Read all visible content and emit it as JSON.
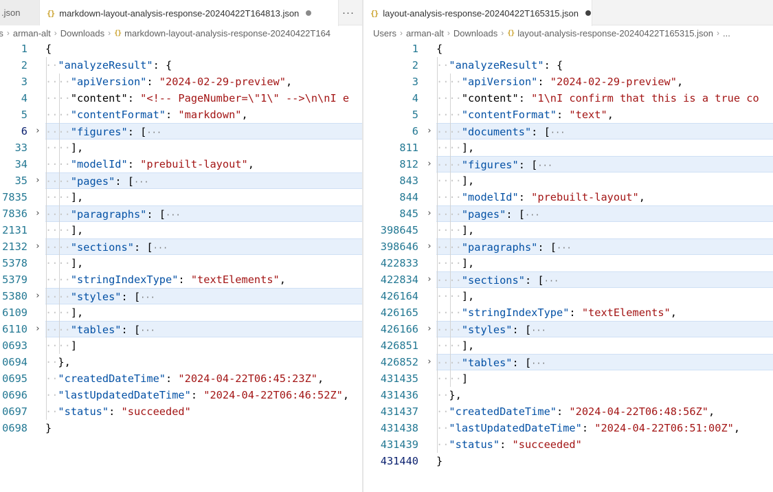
{
  "left": {
    "tabs": [
      {
        "label": ".json",
        "active": false,
        "dirty": false
      },
      {
        "label": "markdown-layout-analysis-response-20240422T164813.json",
        "active": true,
        "dirty": true
      }
    ],
    "more_actions": "···",
    "breadcrumb": [
      "rs",
      "arman-alt",
      "Downloads",
      "markdown-layout-analysis-response-20240422T164"
    ],
    "lines": [
      {
        "n": "1",
        "ind": 0,
        "t": [
          [
            "punc",
            "{"
          ]
        ]
      },
      {
        "n": "2",
        "ind": 1,
        "t": [
          [
            "key",
            "\"analyzeResult\""
          ],
          [
            "punc",
            ": {"
          ]
        ]
      },
      {
        "n": "3",
        "ind": 2,
        "t": [
          [
            "key",
            "\"apiVersion\""
          ],
          [
            "punc",
            ": "
          ],
          [
            "str",
            "\"2024-02-29-preview\""
          ],
          [
            "punc",
            ","
          ]
        ]
      },
      {
        "n": "4",
        "ind": 2,
        "t": [
          [
            "punc",
            "\"content\": "
          ],
          [
            "str",
            "\"<!-- PageNumber=\\\"1\\\" -->\\n\\nI e"
          ]
        ]
      },
      {
        "n": "5",
        "ind": 2,
        "t": [
          [
            "key",
            "\"contentFormat\""
          ],
          [
            "punc",
            ": "
          ],
          [
            "str",
            "\"markdown\""
          ],
          [
            "punc",
            ","
          ]
        ]
      },
      {
        "n": "6",
        "ind": 2,
        "fold": true,
        "current": true,
        "t": [
          [
            "key",
            "\"figures\""
          ],
          [
            "punc",
            ": ["
          ],
          [
            "ellipsis",
            "···"
          ]
        ]
      },
      {
        "n": "33",
        "ind": 2,
        "t": [
          [
            "punc",
            "],"
          ]
        ]
      },
      {
        "n": "34",
        "ind": 2,
        "t": [
          [
            "key",
            "\"modelId\""
          ],
          [
            "punc",
            ": "
          ],
          [
            "str",
            "\"prebuilt-layout\""
          ],
          [
            "punc",
            ","
          ]
        ]
      },
      {
        "n": "35",
        "ind": 2,
        "fold": true,
        "t": [
          [
            "key",
            "\"pages\""
          ],
          [
            "punc",
            ": ["
          ],
          [
            "ellipsis",
            "···"
          ]
        ]
      },
      {
        "n": "7835",
        "ind": 2,
        "t": [
          [
            "punc",
            "],"
          ]
        ]
      },
      {
        "n": "7836",
        "ind": 2,
        "fold": true,
        "t": [
          [
            "key",
            "\"paragraphs\""
          ],
          [
            "punc",
            ": ["
          ],
          [
            "ellipsis",
            "···"
          ]
        ]
      },
      {
        "n": "2131",
        "ind": 2,
        "t": [
          [
            "punc",
            "],"
          ]
        ]
      },
      {
        "n": "2132",
        "ind": 2,
        "fold": true,
        "t": [
          [
            "key",
            "\"sections\""
          ],
          [
            "punc",
            ": ["
          ],
          [
            "ellipsis",
            "···"
          ]
        ]
      },
      {
        "n": "5378",
        "ind": 2,
        "t": [
          [
            "punc",
            "],"
          ]
        ]
      },
      {
        "n": "5379",
        "ind": 2,
        "t": [
          [
            "key",
            "\"stringIndexType\""
          ],
          [
            "punc",
            ": "
          ],
          [
            "str",
            "\"textElements\""
          ],
          [
            "punc",
            ","
          ]
        ]
      },
      {
        "n": "5380",
        "ind": 2,
        "fold": true,
        "t": [
          [
            "key",
            "\"styles\""
          ],
          [
            "punc",
            ": ["
          ],
          [
            "ellipsis",
            "···"
          ]
        ]
      },
      {
        "n": "6109",
        "ind": 2,
        "t": [
          [
            "punc",
            "],"
          ]
        ]
      },
      {
        "n": "6110",
        "ind": 2,
        "fold": true,
        "t": [
          [
            "key",
            "\"tables\""
          ],
          [
            "punc",
            ": ["
          ],
          [
            "ellipsis",
            "···"
          ]
        ]
      },
      {
        "n": "0693",
        "ind": 2,
        "t": [
          [
            "punc",
            "]"
          ]
        ]
      },
      {
        "n": "0694",
        "ind": 1,
        "t": [
          [
            "punc",
            "},"
          ]
        ]
      },
      {
        "n": "0695",
        "ind": 1,
        "t": [
          [
            "key",
            "\"createdDateTime\""
          ],
          [
            "punc",
            ": "
          ],
          [
            "str",
            "\"2024-04-22T06:45:23Z\""
          ],
          [
            "punc",
            ","
          ]
        ]
      },
      {
        "n": "0696",
        "ind": 1,
        "t": [
          [
            "key",
            "\"lastUpdatedDateTime\""
          ],
          [
            "punc",
            ": "
          ],
          [
            "str",
            "\"2024-04-22T06:46:52Z\""
          ],
          [
            "punc",
            ","
          ]
        ]
      },
      {
        "n": "0697",
        "ind": 1,
        "t": [
          [
            "key",
            "\"status\""
          ],
          [
            "punc",
            ": "
          ],
          [
            "str",
            "\"succeeded\""
          ]
        ]
      },
      {
        "n": "0698",
        "ind": 0,
        "t": [
          [
            "punc",
            "}"
          ]
        ]
      }
    ]
  },
  "right": {
    "tabs": [
      {
        "label": "layout-analysis-response-20240422T165315.json",
        "active": true,
        "dirty": true
      }
    ],
    "breadcrumb": [
      "Users",
      "arman-alt",
      "Downloads",
      "layout-analysis-response-20240422T165315.json",
      "..."
    ],
    "lines": [
      {
        "n": "1",
        "ind": 0,
        "t": [
          [
            "punc",
            "{"
          ]
        ]
      },
      {
        "n": "2",
        "ind": 1,
        "t": [
          [
            "key",
            "\"analyzeResult\""
          ],
          [
            "punc",
            ": {"
          ]
        ]
      },
      {
        "n": "3",
        "ind": 2,
        "t": [
          [
            "key",
            "\"apiVersion\""
          ],
          [
            "punc",
            ": "
          ],
          [
            "str",
            "\"2024-02-29-preview\""
          ],
          [
            "punc",
            ","
          ]
        ]
      },
      {
        "n": "4",
        "ind": 2,
        "t": [
          [
            "punc",
            "\"content\": "
          ],
          [
            "str",
            "\"1\\nI confirm that this is a true co"
          ]
        ]
      },
      {
        "n": "5",
        "ind": 2,
        "t": [
          [
            "key",
            "\"contentFormat\""
          ],
          [
            "punc",
            ": "
          ],
          [
            "str",
            "\"text\""
          ],
          [
            "punc",
            ","
          ]
        ]
      },
      {
        "n": "6",
        "ind": 2,
        "fold": true,
        "t": [
          [
            "key",
            "\"documents\""
          ],
          [
            "punc",
            ": ["
          ],
          [
            "ellipsis",
            "···"
          ]
        ]
      },
      {
        "n": "811",
        "ind": 2,
        "t": [
          [
            "punc",
            "],"
          ]
        ]
      },
      {
        "n": "812",
        "ind": 2,
        "fold": true,
        "t": [
          [
            "key",
            "\"figures\""
          ],
          [
            "punc",
            ": ["
          ],
          [
            "ellipsis",
            "···"
          ]
        ]
      },
      {
        "n": "843",
        "ind": 2,
        "t": [
          [
            "punc",
            "],"
          ]
        ]
      },
      {
        "n": "844",
        "ind": 2,
        "t": [
          [
            "key",
            "\"modelId\""
          ],
          [
            "punc",
            ": "
          ],
          [
            "str",
            "\"prebuilt-layout\""
          ],
          [
            "punc",
            ","
          ]
        ]
      },
      {
        "n": "845",
        "ind": 2,
        "fold": true,
        "t": [
          [
            "key",
            "\"pages\""
          ],
          [
            "punc",
            ": ["
          ],
          [
            "ellipsis",
            "···"
          ]
        ]
      },
      {
        "n": "398645",
        "ind": 2,
        "t": [
          [
            "punc",
            "],"
          ]
        ]
      },
      {
        "n": "398646",
        "ind": 2,
        "fold": true,
        "t": [
          [
            "key",
            "\"paragraphs\""
          ],
          [
            "punc",
            ": ["
          ],
          [
            "ellipsis",
            "···"
          ]
        ]
      },
      {
        "n": "422833",
        "ind": 2,
        "t": [
          [
            "punc",
            "],"
          ]
        ]
      },
      {
        "n": "422834",
        "ind": 2,
        "fold": true,
        "t": [
          [
            "key",
            "\"sections\""
          ],
          [
            "punc",
            ": ["
          ],
          [
            "ellipsis",
            "···"
          ]
        ]
      },
      {
        "n": "426164",
        "ind": 2,
        "t": [
          [
            "punc",
            "],"
          ]
        ]
      },
      {
        "n": "426165",
        "ind": 2,
        "t": [
          [
            "key",
            "\"stringIndexType\""
          ],
          [
            "punc",
            ": "
          ],
          [
            "str",
            "\"textElements\""
          ],
          [
            "punc",
            ","
          ]
        ]
      },
      {
        "n": "426166",
        "ind": 2,
        "fold": true,
        "t": [
          [
            "key",
            "\"styles\""
          ],
          [
            "punc",
            ": ["
          ],
          [
            "ellipsis",
            "···"
          ]
        ]
      },
      {
        "n": "426851",
        "ind": 2,
        "t": [
          [
            "punc",
            "],"
          ]
        ]
      },
      {
        "n": "426852",
        "ind": 2,
        "fold": true,
        "t": [
          [
            "key",
            "\"tables\""
          ],
          [
            "punc",
            ": ["
          ],
          [
            "ellipsis",
            "···"
          ]
        ]
      },
      {
        "n": "431435",
        "ind": 2,
        "t": [
          [
            "punc",
            "]"
          ]
        ]
      },
      {
        "n": "431436",
        "ind": 1,
        "t": [
          [
            "punc",
            "},"
          ]
        ]
      },
      {
        "n": "431437",
        "ind": 1,
        "t": [
          [
            "key",
            "\"createdDateTime\""
          ],
          [
            "punc",
            ": "
          ],
          [
            "str",
            "\"2024-04-22T06:48:56Z\""
          ],
          [
            "punc",
            ","
          ]
        ]
      },
      {
        "n": "431438",
        "ind": 1,
        "t": [
          [
            "key",
            "\"lastUpdatedDateTime\""
          ],
          [
            "punc",
            ": "
          ],
          [
            "str",
            "\"2024-04-22T06:51:00Z\""
          ],
          [
            "punc",
            ","
          ]
        ]
      },
      {
        "n": "431439",
        "ind": 1,
        "t": [
          [
            "key",
            "\"status\""
          ],
          [
            "punc",
            ": "
          ],
          [
            "str",
            "\"succeeded\""
          ]
        ]
      },
      {
        "n": "431440",
        "ind": 0,
        "current": true,
        "t": [
          [
            "punc",
            "}"
          ]
        ]
      }
    ]
  },
  "colors": {
    "key": "#0451a5",
    "string": "#a31515",
    "line_number": "#237893",
    "folded_highlight": "#e7f0fb",
    "dirty_dot": "#424242",
    "json_icon": "#cba22c"
  },
  "icons": {
    "file_type": "json-braces-icon",
    "fold": "chevron-right-icon",
    "more": "ellipsis-icon"
  }
}
